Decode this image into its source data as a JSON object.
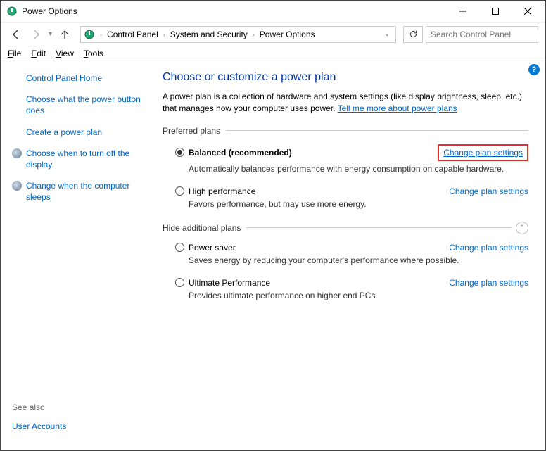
{
  "window": {
    "title": "Power Options"
  },
  "breadcrumb": [
    "Control Panel",
    "System and Security",
    "Power Options"
  ],
  "search": {
    "placeholder": "Search Control Panel"
  },
  "menu": {
    "file": "File",
    "edit": "Edit",
    "view": "View",
    "tools": "Tools"
  },
  "sidebar": {
    "home": "Control Panel Home",
    "items": [
      {
        "label": "Choose what the power button does",
        "icon": false
      },
      {
        "label": "Create a power plan",
        "icon": false
      },
      {
        "label": "Choose when to turn off the display",
        "icon": true
      },
      {
        "label": "Change when the computer sleeps",
        "icon": true
      }
    ],
    "see_also_label": "See also",
    "user_accounts": "User Accounts"
  },
  "main": {
    "heading": "Choose or customize a power plan",
    "description": "A power plan is a collection of hardware and system settings (like display brightness, sleep, etc.) that manages how your computer uses power. ",
    "tell_me_more": "Tell me more about power plans",
    "preferred_label": "Preferred plans",
    "hide_label": "Hide additional plans",
    "change_link": "Change plan settings",
    "plans_preferred": [
      {
        "name": "Balanced (recommended)",
        "desc": "Automatically balances performance with energy consumption on capable hardware.",
        "checked": true,
        "highlight": true
      },
      {
        "name": "High performance",
        "desc": "Favors performance, but may use more energy.",
        "checked": false,
        "highlight": false
      }
    ],
    "plans_additional": [
      {
        "name": "Power saver",
        "desc": "Saves energy by reducing your computer's performance where possible.",
        "checked": false
      },
      {
        "name": "Ultimate Performance",
        "desc": "Provides ultimate performance on higher end PCs.",
        "checked": false
      }
    ]
  }
}
